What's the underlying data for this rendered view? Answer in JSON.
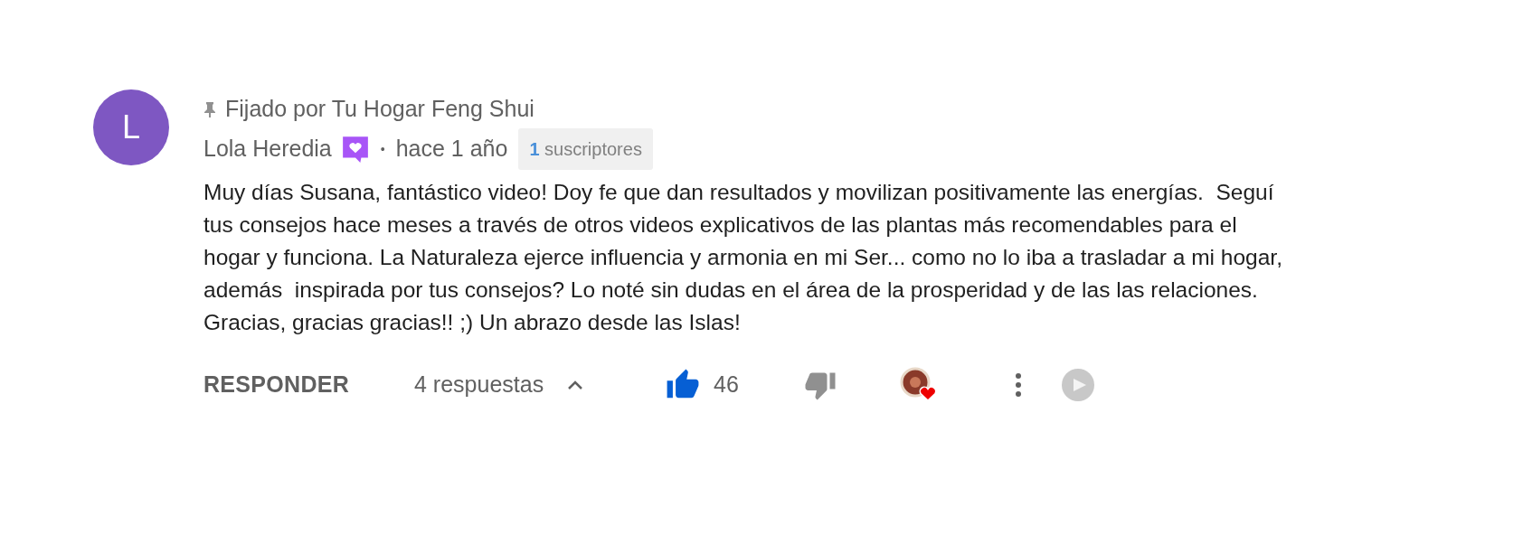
{
  "comment": {
    "avatar_letter": "L",
    "pinned_by": "Fijado por Tu Hogar Feng Shui",
    "author": "Lola Heredia",
    "member_badge": true,
    "separator": "•",
    "time": "hace 1 año",
    "subscriber_badge": {
      "count": "1",
      "label": "suscriptores"
    },
    "body_lines": [
      "Muy días Susana, fantástico video! Doy fe que dan resultados y movilizan positivamente las energías.  Seguí",
      "tus consejos hace meses a través de otros videos explicativos de las plantas más recomendables para el",
      "hogar y funciona. La Naturaleza ejerce influencia y armonia en mi Ser... como no lo iba a trasladar a mi hogar,",
      "además  inspirada por tus consejos? Lo noté sin dudas en el área de la prosperidad y de las las relaciones.",
      "Gracias, gracias gracias!! ;) Un abrazo desde las Islas!"
    ],
    "actions": {
      "reply": "RESPONDER",
      "replies": "4 respuestas",
      "replies_expanded": true,
      "like_count": "46",
      "liked": true,
      "disliked": false,
      "creator_heart": true
    }
  }
}
